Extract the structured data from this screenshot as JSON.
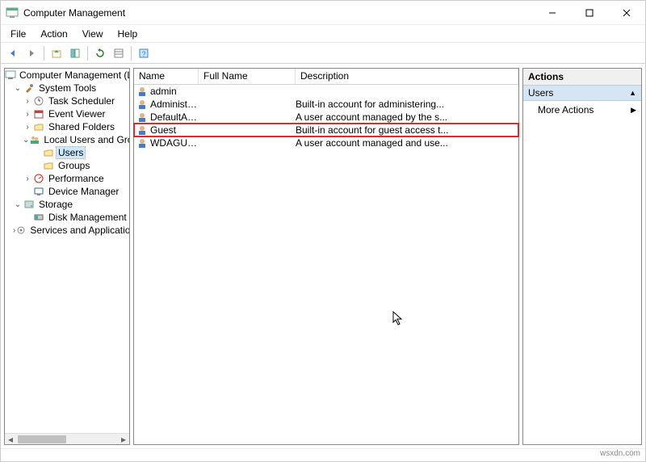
{
  "window": {
    "title": "Computer Management"
  },
  "menu": {
    "file": "File",
    "action": "Action",
    "view": "View",
    "help": "Help"
  },
  "tree": {
    "root": "Computer Management (Local",
    "system_tools": "System Tools",
    "task_scheduler": "Task Scheduler",
    "event_viewer": "Event Viewer",
    "shared_folders": "Shared Folders",
    "local_users": "Local Users and Groups",
    "users": "Users",
    "groups": "Groups",
    "performance": "Performance",
    "device_manager": "Device Manager",
    "storage": "Storage",
    "disk_management": "Disk Management",
    "services_apps": "Services and Applications"
  },
  "list": {
    "col_name": "Name",
    "col_full": "Full Name",
    "col_desc": "Description",
    "rows": [
      {
        "name": "admin",
        "full": "",
        "desc": ""
      },
      {
        "name": "Administrator",
        "full": "",
        "desc": "Built-in account for administering..."
      },
      {
        "name": "DefaultAcco...",
        "full": "",
        "desc": "A user account managed by the s..."
      },
      {
        "name": "Guest",
        "full": "",
        "desc": "Built-in account for guest access t..."
      },
      {
        "name": "WDAGUtility...",
        "full": "",
        "desc": "A user account managed and use..."
      }
    ]
  },
  "actions": {
    "title": "Actions",
    "section": "Users",
    "more": "More Actions"
  },
  "footer": "wsxdn.com"
}
